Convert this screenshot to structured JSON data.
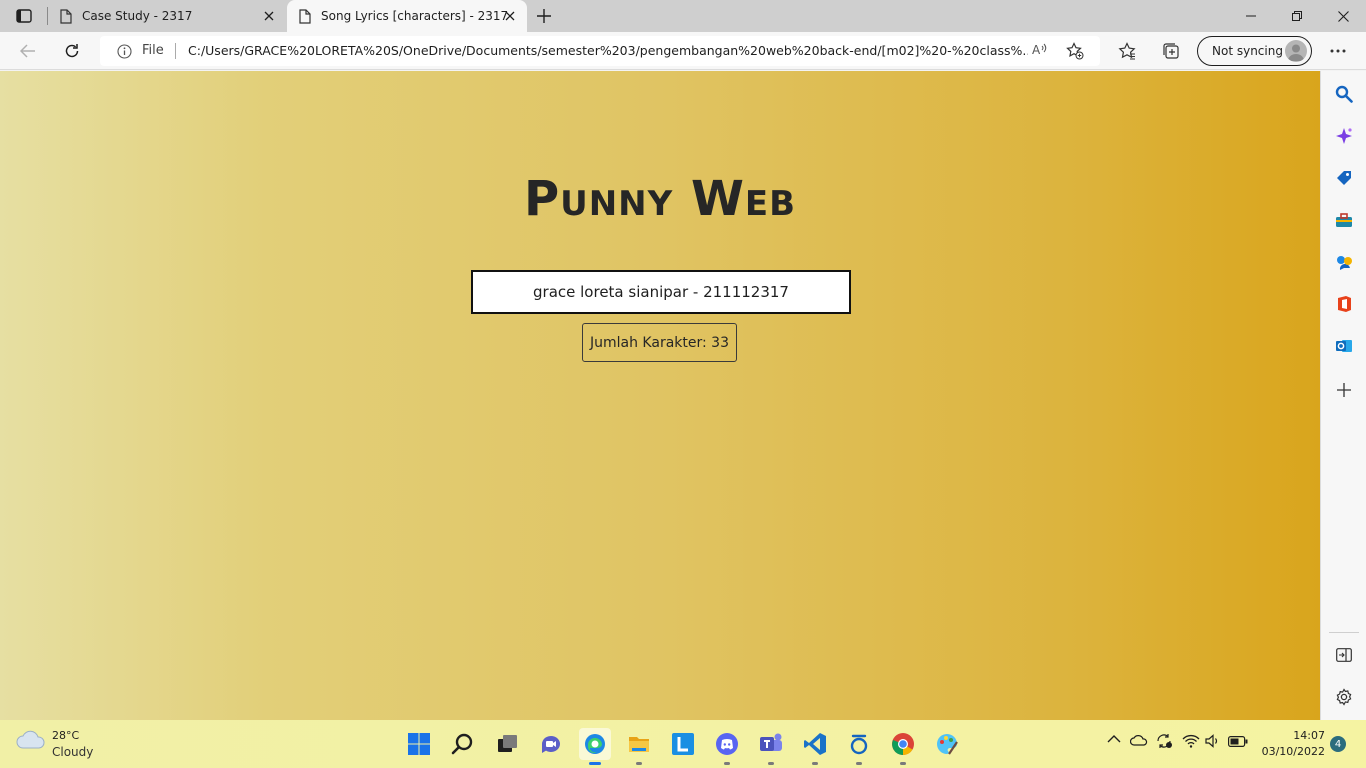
{
  "browser": {
    "tabs": [
      {
        "title": "Case Study - 2317",
        "active": false
      },
      {
        "title": "Song Lyrics [characters] - 2317",
        "active": true
      }
    ],
    "address": {
      "scheme_label": "File",
      "url": "C:/Users/GRACE%20LORETA%20S/OneDrive/Documents/semester%203/pengembangan%20web%20back-end/[m02]%20-%20class%..."
    },
    "profile_label": "Not syncing"
  },
  "page": {
    "title": "Punny Web",
    "input_value": "grace loreta sianipar - 211112317",
    "count_label": "Jumlah Karakter: 33",
    "background_colors": [
      "#e6dfa2",
      "#d9a51c"
    ]
  },
  "sidebar": {
    "items": [
      "search-icon",
      "copilot-icon",
      "shopping-tag-icon",
      "tools-icon",
      "games-icon",
      "office-icon",
      "outlook-icon",
      "add-icon"
    ],
    "bottom_items": [
      "split-screen-icon",
      "settings-icon"
    ]
  },
  "taskbar": {
    "weather": {
      "temp": "28°C",
      "condition": "Cloudy"
    },
    "apps": [
      "windows-start",
      "search",
      "task-view",
      "chat",
      "edge",
      "file-explorer",
      "l-app",
      "discord",
      "teams",
      "vscode",
      "circle-app",
      "chrome",
      "paint"
    ],
    "clock": {
      "time": "14:07",
      "date": "03/10/2022"
    },
    "notification_count": "4"
  }
}
